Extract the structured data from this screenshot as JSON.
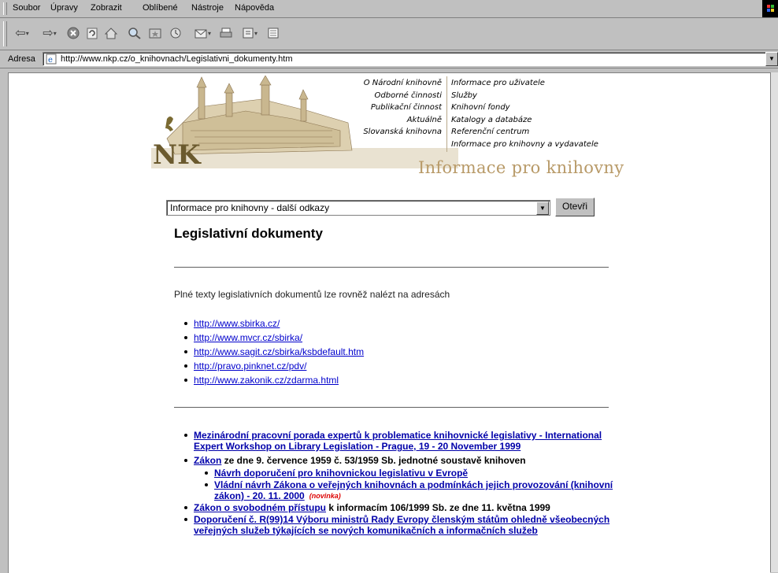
{
  "menu": [
    "Soubor",
    "Úpravy",
    "Zobrazit",
    "Oblíbené",
    "Nástroje",
    "Nápověda"
  ],
  "toolbar_icons": [
    "back-arrow-icon",
    "forward-arrow-icon",
    "stop-icon",
    "refresh-icon",
    "home-icon",
    "search-icon",
    "favorites-icon",
    "history-icon",
    "mail-icon",
    "print-icon",
    "edit-icon",
    "discuss-icon"
  ],
  "address": {
    "label": "Adresa",
    "url": "http://www.nkp.cz/o_knihovnach/Legislativni_dokumenty.htm"
  },
  "header": {
    "logo_text": "NK",
    "nav_left": [
      "O Národní knihovně",
      "Odborné činnosti",
      "Publikační činnost",
      "Aktuálně",
      "Slovanská knihovna"
    ],
    "nav_right": [
      "Informace pro uživatele",
      "Služby",
      "Knihovní fondy",
      "Katalogy a databáze",
      "Referenční centrum",
      "Informace pro knihovny a vydavatele"
    ],
    "section_title": "Informace pro knihovny"
  },
  "select": {
    "value": "Informace pro knihovny - další odkazy",
    "button": "Otevři"
  },
  "page_title": "Legislativní dokumenty",
  "intro": "Plné texty legislativních dokumentů lze rovněž nalézt na adresách",
  "links": [
    "http://www.sbirka.cz/",
    "http://www.mvcr.cz/sbirka/",
    "http://www.sagit.cz/sbirka/ksbdefault.htm",
    "http://pravo.pinknet.cz/pdv/",
    "http://www.zakonik.cz/zdarma.html"
  ],
  "items": {
    "i1": "Mezinárodní pracovní porada expertů k problematice knihovnické legislativy - International Expert Workshop on Library Legislation - Prague, 19 - 20 November 1999",
    "i2_link": "Zákon",
    "i2_text": " ze dne 9. července 1959 č. 53/1959 Sb. jednotné soustavě knihoven",
    "i2_sub1": "Návrh doporučení pro knihovnickou legislativu v Evropě",
    "i2_sub2": "Vládní návrh Zákona o veřejných knihovnách a podmínkách jejich provozování (knihovní zákon) - 20. 11. 2000",
    "novinka": "(novinka)",
    "i3_link": "Zákon o svobodném přístupu",
    "i3_text": " k informacím 106/1999 Sb. ze dne 11. května 1999",
    "i4": "Doporučení č. R(99)14 Výboru ministrů Rady Evropy členským státům ohledně všeobecných veřejných služeb týkajících se nových komunikačních a informačních služeb"
  }
}
